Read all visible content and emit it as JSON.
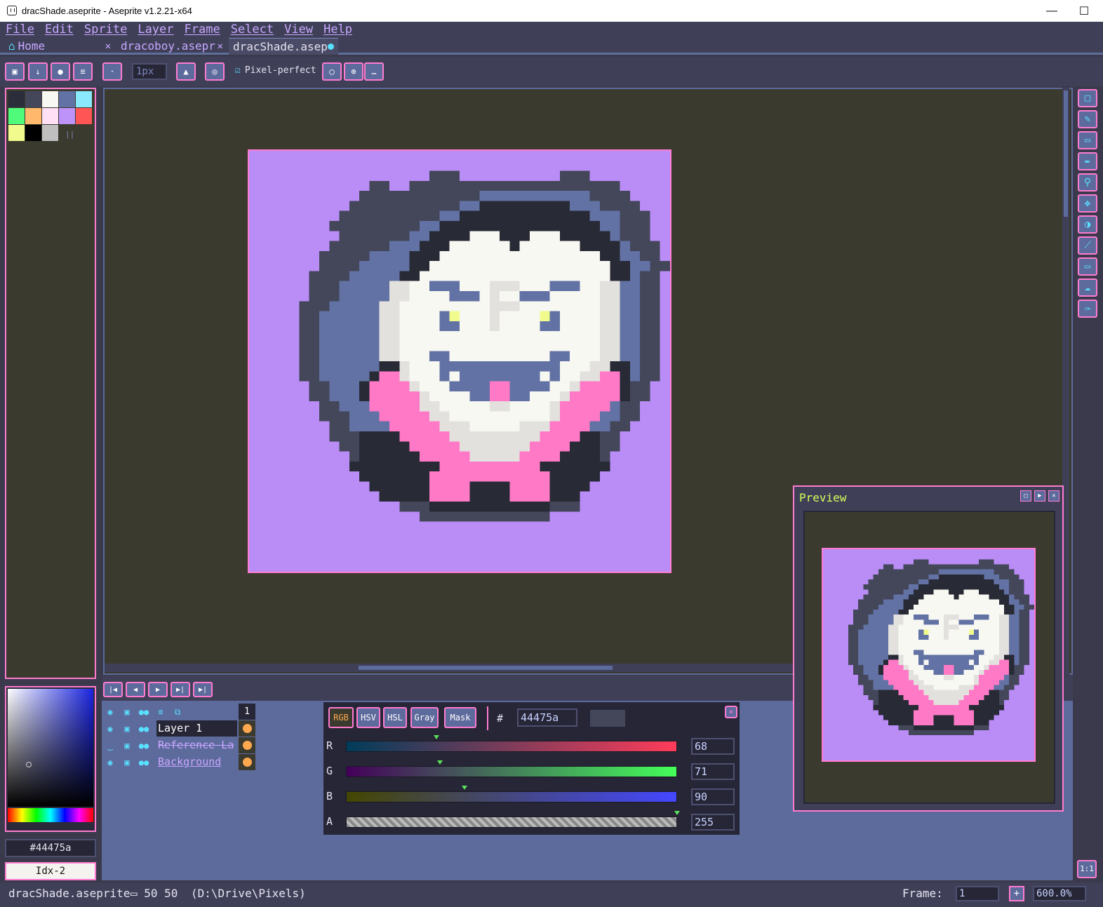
{
  "window": {
    "title": "dracShade.aseprite - Aseprite v1.2.21-x64"
  },
  "menu": [
    "File",
    "Edit",
    "Sprite",
    "Layer",
    "Frame",
    "Select",
    "View",
    "Help"
  ],
  "tabs": [
    {
      "label": "Home"
    },
    {
      "label": "dracoboy.asepr"
    },
    {
      "label": "dracShade.asep"
    }
  ],
  "context_bar": {
    "brush_size": "1px",
    "pixel_perfect": "Pixel-perfect"
  },
  "palette": [
    "#2b2d3a",
    "#44475a",
    "#f8f8f2",
    "#6272a4",
    "#8be9fd",
    "#50fa7b",
    "#ffb86c",
    "#ffe0f5",
    "#bd93f9",
    "#ff5555",
    "#f1fa8c",
    "#000000",
    "#bfbfbf"
  ],
  "color_bar": {
    "hex": "#44475a",
    "index": "Idx-2"
  },
  "layers": [
    {
      "name": "Layer 1",
      "state": "active"
    },
    {
      "name": "Reference La",
      "state": "hidden"
    },
    {
      "name": "Background",
      "state": "normal"
    }
  ],
  "timeline": {
    "frame_number": "1"
  },
  "color_editor": {
    "modes": [
      "RGB",
      "HSV",
      "HSL",
      "Gray",
      "Mask"
    ],
    "hash": "#",
    "hex": "44475a",
    "channels": [
      {
        "label": "R",
        "value": "68",
        "fraction": 0.267
      },
      {
        "label": "G",
        "value": "71",
        "fraction": 0.278
      },
      {
        "label": "B",
        "value": "90",
        "fraction": 0.353
      },
      {
        "label": "A",
        "value": "255",
        "fraction": 1.0
      }
    ]
  },
  "preview": {
    "title": "Preview"
  },
  "status": {
    "filename": "dracShade.aseprite",
    "size": "50 50",
    "path": "(D:\\Drive\\Pixels)",
    "frame_label": "Frame:",
    "frame": "1",
    "zoom": "600.0%",
    "one_to_one": "1:1"
  },
  "sprite": {
    "rows": [
      "..........................................",
      "..........................................",
      "..................BBB..........BBB........",
      "............BB..BBBBBBBBBBBBBBBBBBBBB.....",
      "...........BBBBBBBBBBBBCCCCCCCCCCCBBBB....",
      "..........BBBBBBBBBBBCCDDDDDDDDDCCCBBBB...",
      ".........BBBBBBBBBBCCDDDDDDDDDDDDDCCCBBB..",
      "........BBBBBBBBBCCDDDDDDDDDDDDDDDDCCBBB..",
      ".........BBBBBBBCCDDDDWWWDDDWWWDDDDDCBBB..",
      "........BBBBBBCCCDDDWWWWWWDWWWWWWDDDDCBBB.",
      ".......BBBBBCCCCDDDWWWWWWWWWWWWWWWWDDCCBB.",
      ".......BBBBCCCCCDDWWWWWWWWWWWWWWWWWWDDCCBB",
      "......BBBBCCCCCDDWWWWWWWWWWWWWWWWWWWDDCBB",
      "......BBBCCCCCGGWWCCCWWWGGGWWWCCCWWGGCCBB",
      "......BBBCCCCCGGWWWWCCCWGWWCCCWWWWWGGCCBB",
      ".....BBBCCCCCGGWWWWWWWWWGGGWWWWWWWWGGCCBB",
      ".....BBCCCCCCGGWWWWCYWWWGWWWWYCWWWWGGCCBB",
      ".....BBCCCCCCGGWWWWCCWWWGWWWWCCWWWWGGCCBB",
      ".....BBCCCCCCGGWWWWWWWWWWWWWWWWWWWWGGCCBB",
      ".....BBCCCCCCGGWWWWWWWWWWWWWWWWWWWWGGCCBB",
      ".....BBCCCCCCGGWWWCCWWWWWWWWWWCCWWWGGCCBB",
      ".....BBCCCCCCDDGWWWCCCCCCCCCCCCWWWGGDDCBB",
      ".....BBCCCCCDPPGWWWCWCCCCCCCCWCWWGGPPDCBB",
      "......BBCCCDPPPPGWWWCCCCPPCCCCWWGPPPPDBB",
      "......BBCCCDPPPPPGWWWWCCPPCCWWWGPPPPPDBB",
      ".......BBCCCPPPPPGGWWWWWGGWWWWGPPPPPCBB",
      ".......BBBCCCPPPPPGGWWWWWWWWWWGPPPPCCBB",
      "........BBCCCCPPPPPGGGWWWWWGGGPPPPCCBB",
      "........BBBDDDDPPPPPGGGGGGGGGPPPPDDBB",
      ".........BBDDDDDPPPPPGGGGGGGPPPPDDDBB",
      "..........BDDDDDDPPPPPGGGGGPPPPDDDDB",
      "..........DDDDDDDDDPPPPPPPPPPDDDDDDD",
      "...........DDDDDDDPPPPPPPPPPPPDDDDD",
      "............DDDDDDPPPPDDDDPPPPDDDD",
      ".............DDDDDPPPPDDDDPPPPDDD",
      "...............BBBDDDDDDDDDDDDBBB",
      ".................BBBBBBBBBBBBB",
      "..........................................",
      "..........................................",
      "..........................................",
      "..........................................",
      ".........................................."
    ],
    "colors": {
      "B": "#44475a",
      "C": "#6272a4",
      "D": "#282a36",
      "W": "#f8f8f2",
      "G": "#e3e1de",
      "P": "#ff79c6",
      "Y": "#f1fa8c"
    }
  }
}
